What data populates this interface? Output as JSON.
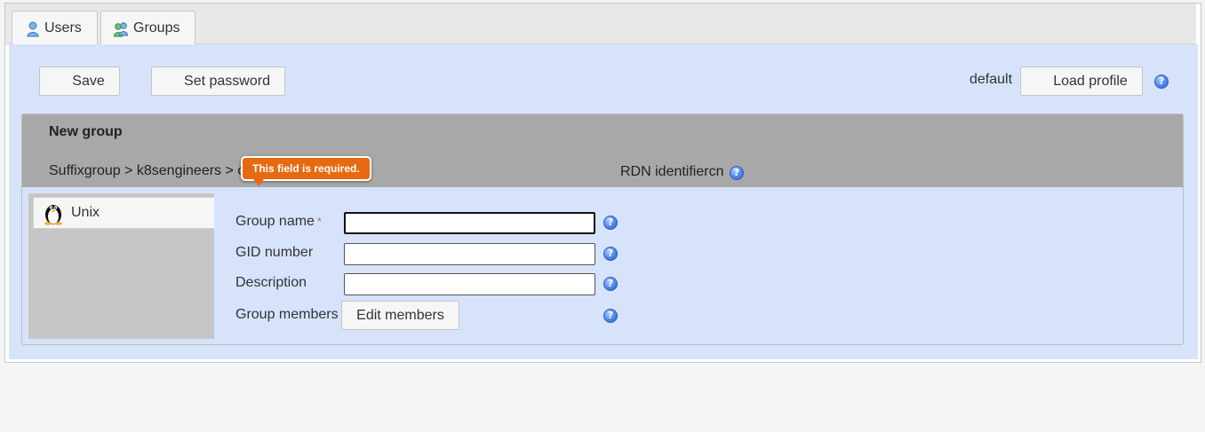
{
  "tabs": [
    {
      "label": "Users",
      "icon": "user-icon"
    },
    {
      "label": "Groups",
      "icon": "groups-icon"
    }
  ],
  "toolbar": {
    "save_label": "Save",
    "set_password_label": "Set password",
    "profile_name": "default",
    "load_profile_label": "Load profile"
  },
  "panel": {
    "title": "New group",
    "breadcrumb": "Suffixgroup > k8sengineers > c",
    "rdn_label": "RDN identifiercn",
    "tooltip": "This field is required."
  },
  "sidebar": {
    "items": [
      {
        "label": "Unix",
        "icon": "penguin-icon"
      }
    ]
  },
  "form": {
    "group_name_label": "Group name",
    "required_marker": "*",
    "gid_label": "GID number",
    "description_label": "Description",
    "members_label": "Group members",
    "edit_members_label": "Edit members",
    "group_name_value": "",
    "gid_value": "",
    "description_value": ""
  },
  "colors": {
    "content_bg": "#d6e3fb",
    "panel_header_bg": "#a8a8a8",
    "tooltip_bg": "#e86a10",
    "help_icon": "#4f86e8"
  }
}
